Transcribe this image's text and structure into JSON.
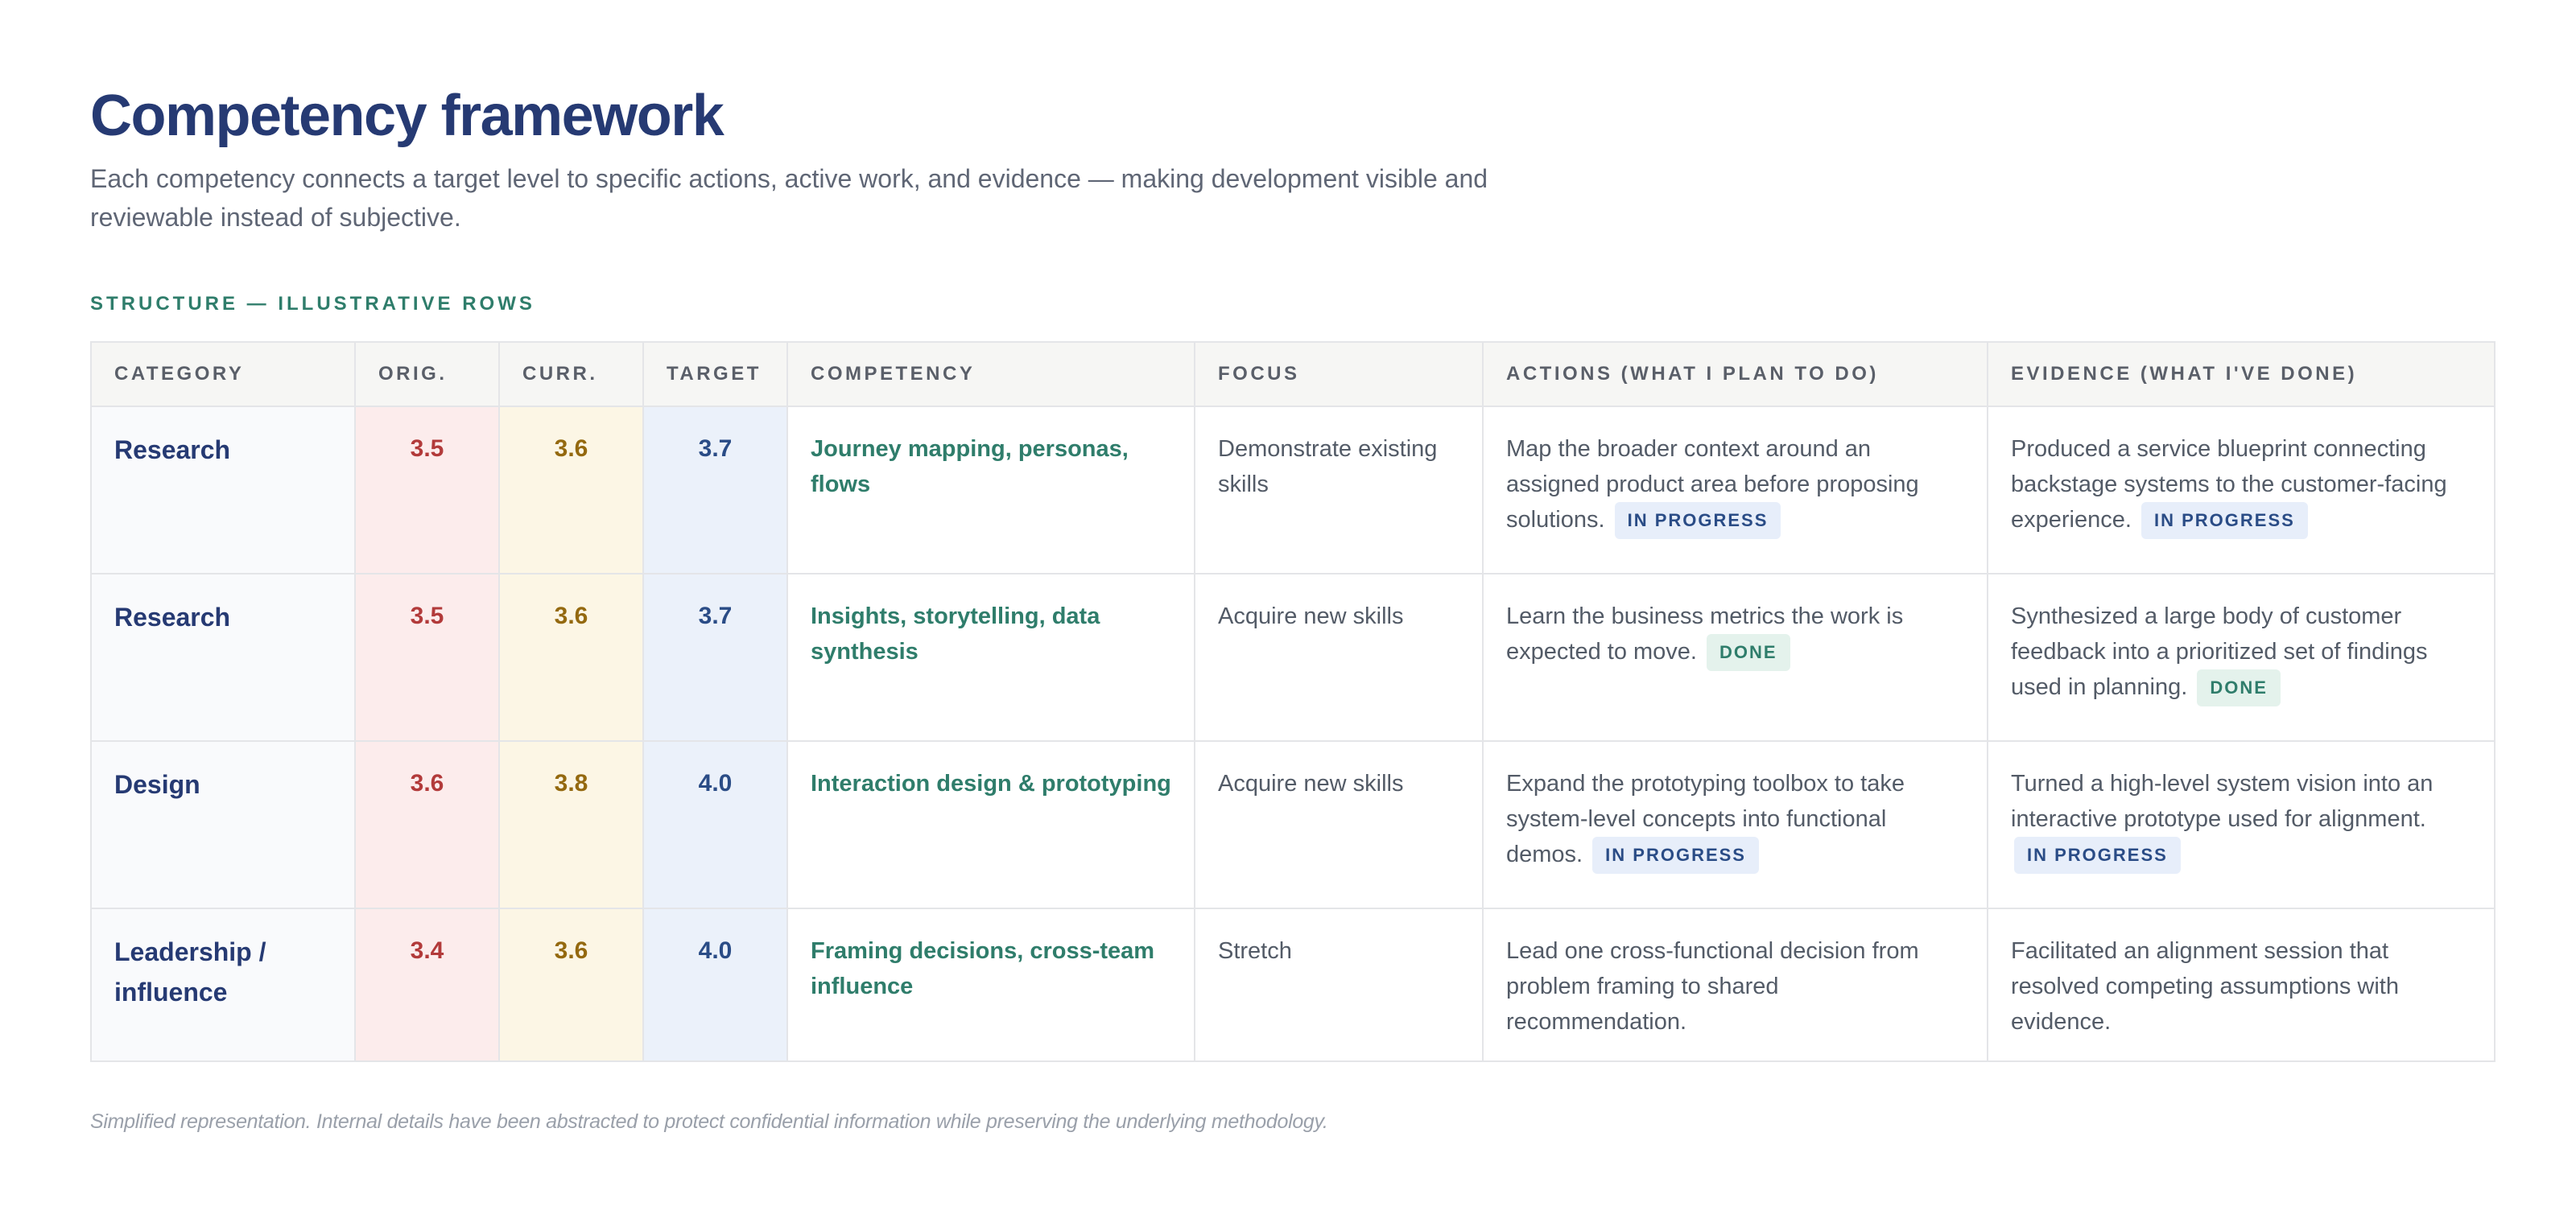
{
  "header": {
    "title": "Competency framework",
    "subtitle": "Each competency connects a target level to specific actions, active work, and evidence — making development visible and reviewable instead of subjective.",
    "section_label": "STRUCTURE — ILLUSTRATIVE ROWS"
  },
  "table": {
    "columns": {
      "category": "CATEGORY",
      "orig": "ORIG.",
      "curr": "CURR.",
      "target": "TARGET",
      "competency": "COMPETENCY",
      "focus": "FOCUS",
      "actions": "ACTIONS (WHAT I PLAN TO DO)",
      "evidence": "EVIDENCE (WHAT I'VE DONE)"
    },
    "rows": [
      {
        "category": "Research",
        "orig": "3.5",
        "curr": "3.6",
        "target": "3.7",
        "competency": "Journey mapping, personas, flows",
        "focus": "Demonstrate existing skills",
        "actions": "Map the broader context around an assigned product area before proposing solutions.",
        "actions_status": "IN PROGRESS",
        "evidence": "Produced a service blueprint connecting backstage systems to the customer-facing experience.",
        "evidence_status": "IN PROGRESS"
      },
      {
        "category": "Research",
        "orig": "3.5",
        "curr": "3.6",
        "target": "3.7",
        "competency": "Insights, storytelling, data synthesis",
        "focus": "Acquire new skills",
        "actions": "Learn the business metrics the work is expected to move.",
        "actions_status": "DONE",
        "evidence": "Synthesized a large body of customer feedback into a prioritized set of findings used in planning.",
        "evidence_status": "DONE"
      },
      {
        "category": "Design",
        "orig": "3.6",
        "curr": "3.8",
        "target": "4.0",
        "competency": "Interaction design & prototyping",
        "focus": "Acquire new skills",
        "actions": "Expand the prototyping toolbox to take system-level concepts into functional demos.",
        "actions_status": "IN PROGRESS",
        "evidence": "Turned a high-level system vision into an interactive prototype used for alignment.",
        "evidence_status": "IN PROGRESS"
      },
      {
        "category": "Leadership / influence",
        "orig": "3.4",
        "curr": "3.6",
        "target": "4.0",
        "competency": "Framing decisions, cross-team influence",
        "focus": "Stretch",
        "actions": "Lead one cross-functional decision from problem framing to shared recommendation.",
        "evidence": "Facilitated an alignment session that resolved competing assumptions with evidence."
      }
    ]
  },
  "footnote": "Simplified representation. Internal details have been abstracted to protect confidential information while preserving the underlying methodology.",
  "colors": {
    "title": "#263a73",
    "accent": "#2f7d6b",
    "orig_bg": "#fcecec",
    "curr_bg": "#fcf6e5",
    "target_bg": "#ebf1fa",
    "in_progress_badge": "#e7eefa",
    "done_badge": "#e4f2ec"
  }
}
